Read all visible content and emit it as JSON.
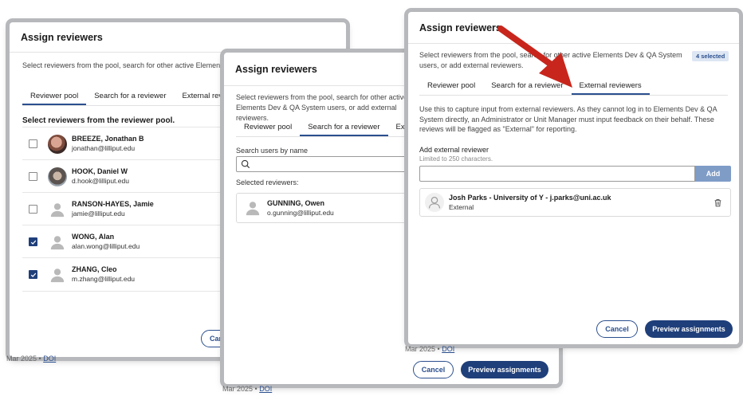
{
  "dialog1": {
    "title": "Assign reviewers",
    "intro": "Select reviewers from the pool, search for other active Elements Dev & QA System users, or add external reviewers.",
    "tabs": [
      "Reviewer pool",
      "Search for a reviewer",
      "External reviewers"
    ],
    "pool_heading": "Select reviewers from the reviewer pool.",
    "reviewers": [
      {
        "name": "BREEZE, Jonathan B",
        "email": "jonathan@lilliput.edu",
        "checked": false,
        "avatar": "photo"
      },
      {
        "name": "HOOK, Daniel W",
        "email": "d.hook@lilliput.edu",
        "checked": false,
        "avatar": "photo"
      },
      {
        "name": "RANSON-HAYES, Jamie",
        "email": "jamie@lilliput.edu",
        "checked": false,
        "avatar": "generic"
      },
      {
        "name": "WONG, Alan",
        "email": "alan.wong@lilliput.edu",
        "checked": true,
        "avatar": "generic"
      },
      {
        "name": "ZHANG, Cleo",
        "email": "m.zhang@lilliput.edu",
        "checked": true,
        "avatar": "generic"
      }
    ],
    "cancel_partial": "Can",
    "behind_date": "Mar 2025 •",
    "behind_doi": "DOI"
  },
  "dialog2": {
    "title": "Assign reviewers",
    "intro": "Select reviewers from the pool, search for other active Elements Dev & QA System users, or add external reviewers.",
    "tabs": [
      "Reviewer pool",
      "Search for a reviewer",
      "Exte"
    ],
    "search_label": "Search users by name",
    "search_value": "",
    "selected_label": "Selected reviewers:",
    "selected": [
      {
        "name": "GUNNING, Owen",
        "email": "o.gunning@lilliput.edu"
      }
    ],
    "cancel": "Cancel",
    "preview": "Preview assignments",
    "behind_date": "Mar 2025 •",
    "behind_doi": "DOI"
  },
  "dialog3": {
    "title": "Assign reviewers",
    "intro": "Select reviewers from the pool, search for other active Elements Dev & QA System users, or add external reviewers.",
    "selected_badge": "4 selected",
    "tabs": [
      "Reviewer pool",
      "Search for a reviewer",
      "External reviewers"
    ],
    "external_info": "Use this to capture input from external reviewers. As they cannot log in to Elements Dev & QA System directly, an Administrator or Unit Manager must input feedback on their behalf. These reviews will be flagged as \"External\" for reporting.",
    "add_label": "Add external reviewer",
    "add_hint": "Limited to 250 characters.",
    "add_value": "",
    "add_button": "Add",
    "external_entry_name": "Josh Parks - University of Y - j.parks@uni.ac.uk",
    "external_entry_tag": "External",
    "cancel": "Cancel",
    "preview": "Preview assignments",
    "behind_date": "Mar 2025 •",
    "behind_doi": "DOI"
  },
  "colors": {
    "primary": "#1f3f7a",
    "accent_arrow": "#c8261c",
    "badge_bg": "#dde6f3"
  }
}
